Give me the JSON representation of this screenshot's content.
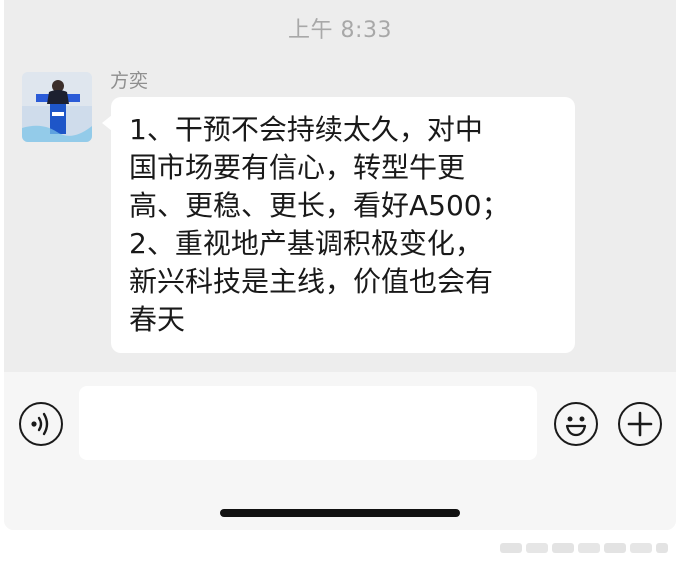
{
  "chat": {
    "timestamp": "上午 8:33",
    "messages": [
      {
        "sender": "方奕",
        "text": "1、干预不会持续太久，对中\n国市场要有信心，转型牛更\n高、更稳、更长，看好A500；\n2、重视地产基调积极变化，\n新兴科技是主线，价值也会有\n春天"
      }
    ]
  },
  "input_bar": {
    "value": "",
    "voice_icon": "voice-icon",
    "emoji_icon": "smiley-icon",
    "plus_icon": "plus-icon"
  },
  "colors": {
    "chat_background": "#ededed",
    "bubble": "#ffffff",
    "input_bar": "#f6f6f6",
    "text": "#191919",
    "muted_text": "#a8a8a8"
  }
}
